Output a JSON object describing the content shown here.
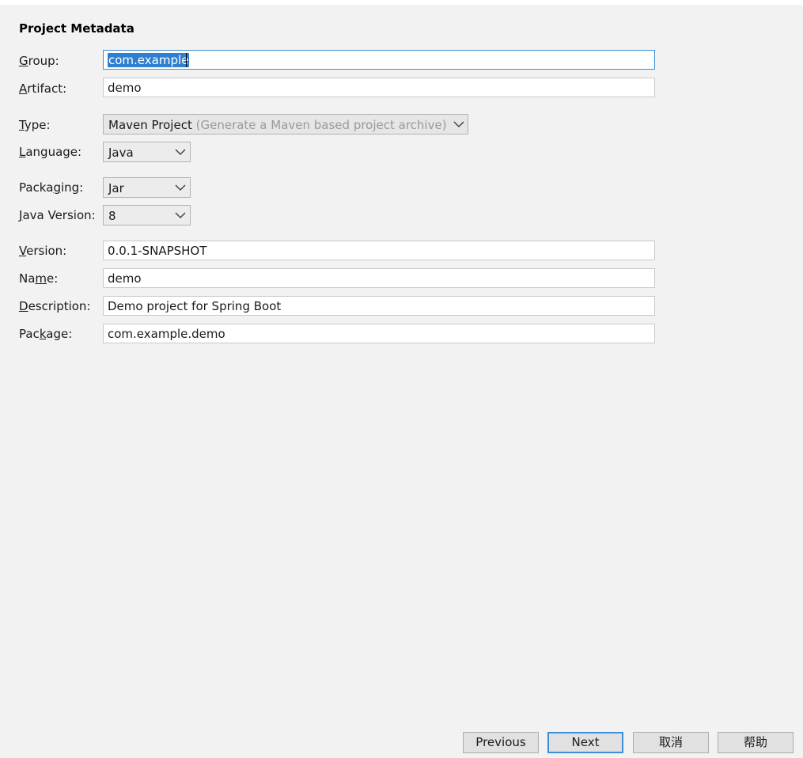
{
  "section_title": "Project Metadata",
  "fields": {
    "group": {
      "label_pre": "",
      "label_mn": "G",
      "label_post": "roup:",
      "value": "com.example"
    },
    "artifact": {
      "label_pre": "",
      "label_mn": "A",
      "label_post": "rtifact:",
      "value": "demo"
    },
    "type": {
      "label_pre": "",
      "label_mn": "T",
      "label_post": "ype:",
      "value": "Maven Project",
      "hint": "(Generate a Maven based project archive)"
    },
    "language": {
      "label_pre": "",
      "label_mn": "L",
      "label_post": "anguage:",
      "value": "Java"
    },
    "packaging": {
      "label_pre": "Packa",
      "label_mn": "g",
      "label_post": "ing:",
      "value": "Jar"
    },
    "java_version": {
      "label_pre": "",
      "label_mn": "J",
      "label_post": "ava Version:",
      "value": "8"
    },
    "version": {
      "label_pre": "",
      "label_mn": "V",
      "label_post": "ersion:",
      "value": "0.0.1-SNAPSHOT"
    },
    "name": {
      "label_pre": "Na",
      "label_mn": "m",
      "label_post": "e:",
      "value": "demo"
    },
    "description": {
      "label_pre": "",
      "label_mn": "D",
      "label_post": "escription:",
      "value": "Demo project for Spring Boot"
    },
    "package": {
      "label_pre": "Pac",
      "label_mn": "k",
      "label_post": "age:",
      "value": "com.example.demo"
    }
  },
  "buttons": {
    "previous": "Previous",
    "next": "Next",
    "cancel": "取消",
    "help": "帮助"
  },
  "icons": {
    "dropdown": "chevron-down-icon"
  },
  "colors": {
    "focus_border": "#3c8fd6",
    "selection": "#2f7fd1",
    "background": "#f2f2f2"
  }
}
